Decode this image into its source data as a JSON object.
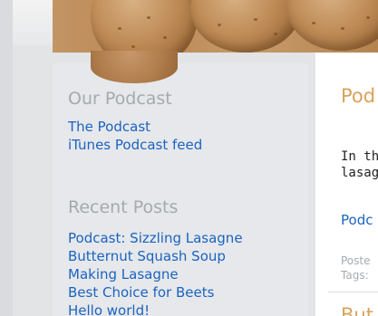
{
  "sidebar": {
    "podcast_widget": {
      "title": "Our Podcast",
      "links": [
        {
          "label": "The Podcast"
        },
        {
          "label": "iTunes Podcast feed"
        }
      ]
    },
    "recent_posts_widget": {
      "title": "Recent Posts",
      "links": [
        {
          "label": "Podcast: Sizzling Lasagne"
        },
        {
          "label": "Butternut Squash Soup"
        },
        {
          "label": "Making Lasagne"
        },
        {
          "label": "Best Choice for Beets"
        },
        {
          "label": "Hello world!"
        }
      ]
    }
  },
  "content": {
    "post_title": "Pod",
    "excerpt_line1": "In th",
    "excerpt_line2": "lasag",
    "post_link": "Podc",
    "meta_posted": "Poste",
    "meta_tags": "Tags:",
    "next_post_title": "But"
  },
  "colors": {
    "link": "#1c63c0",
    "widget_title": "#a4aaae",
    "post_title": "#d8a25a",
    "sidebar_bg": "#e6e8eb"
  }
}
